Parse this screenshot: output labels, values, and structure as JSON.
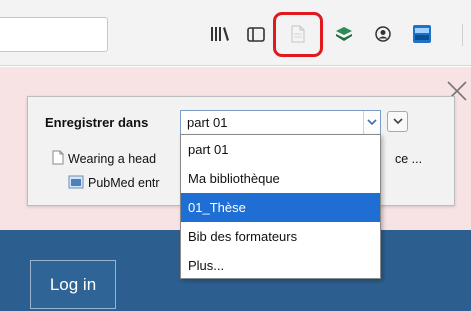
{
  "dialog": {
    "save_in_label": "Enregistrer dans",
    "selected_collection": "part 01",
    "item_title": "Wearing a head",
    "item_title_tail": "ce ...",
    "item_source": "PubMed entr"
  },
  "dropdown": {
    "options": [
      "part 01",
      "Ma bibliothèque",
      "01_Thèse",
      "Bib des formateurs",
      "Plus..."
    ],
    "highlighted": "01_Thèse"
  },
  "page": {
    "login_label": "Log in"
  },
  "toolbar": {
    "icons": [
      "library-icon",
      "sidebar-icon",
      "zotero-save-icon",
      "layers-icon",
      "account-icon",
      "pan-icon"
    ]
  },
  "colors": {
    "highlight_outline": "#e0191f",
    "selection": "#1f6ed4",
    "page_pink": "#f7e3e4",
    "page_blue": "#2c5f8f"
  }
}
